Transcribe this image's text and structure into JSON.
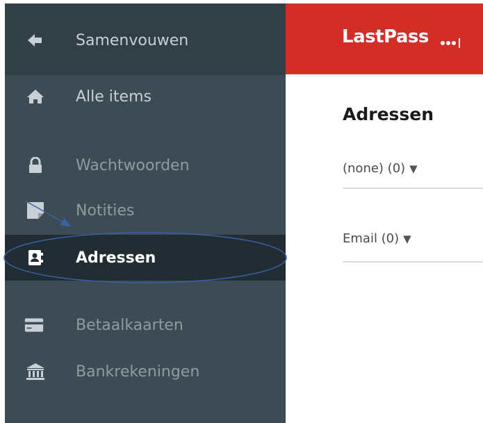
{
  "sidebar": {
    "collapse_label": "Samenvouwen",
    "items": [
      {
        "label": "Alle items",
        "icon": "home-icon"
      },
      {
        "label": "Wachtwoorden",
        "icon": "lock-icon"
      },
      {
        "label": "Notities",
        "icon": "note-icon"
      },
      {
        "label": "Adressen",
        "icon": "address-book-icon",
        "active": true
      },
      {
        "label": "Betaalkaarten",
        "icon": "credit-card-icon"
      },
      {
        "label": "Bankrekeningen",
        "icon": "bank-icon"
      }
    ]
  },
  "header": {
    "logo_text": "LastPass",
    "brand_color": "#d32d27"
  },
  "main": {
    "title": "Adressen",
    "dropdowns": [
      {
        "label": "(none) (0)"
      },
      {
        "label": "Email (0)"
      }
    ]
  },
  "annotation": {
    "color": "#3d5fa8",
    "shapes": [
      "arrow",
      "ellipse"
    ]
  }
}
